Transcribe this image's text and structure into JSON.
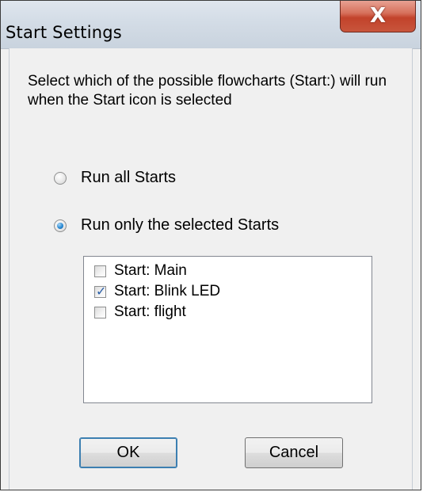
{
  "window": {
    "title": "Start Settings",
    "close_label": "X"
  },
  "description": "Select which of the possible flowcharts (Start:) will run when the Start icon is selected",
  "options": {
    "run_all": {
      "label": "Run all Starts",
      "selected": false
    },
    "run_selected": {
      "label": "Run only the selected Starts",
      "selected": true
    }
  },
  "starts": [
    {
      "label": "Start: Main",
      "checked": false
    },
    {
      "label": "Start: Blink LED",
      "checked": true
    },
    {
      "label": "Start: flight",
      "checked": false
    }
  ],
  "buttons": {
    "ok": "OK",
    "cancel": "Cancel"
  }
}
